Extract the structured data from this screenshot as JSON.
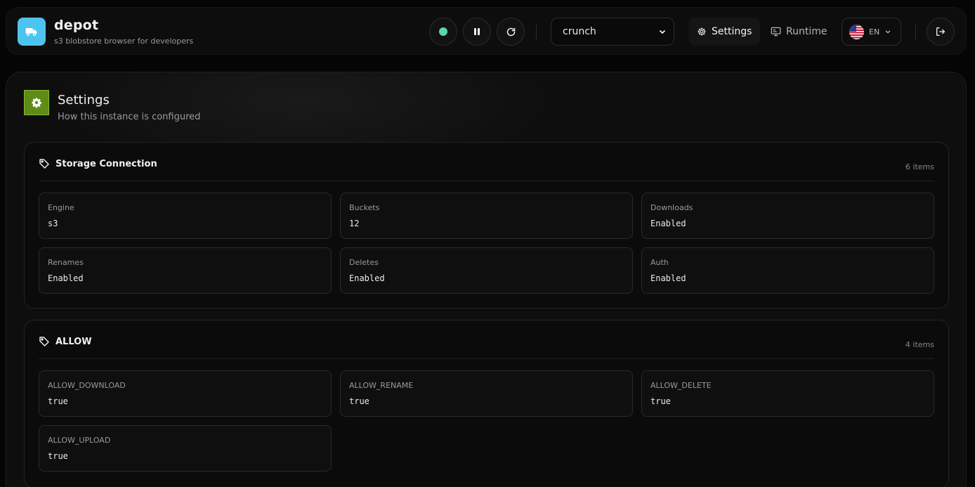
{
  "app": {
    "title": "depot",
    "subtitle": "s3 blobstore browser for developers"
  },
  "header": {
    "bucket_select": {
      "value": "crunch"
    },
    "nav": {
      "settings": "Settings",
      "runtime": "Runtime"
    },
    "language": {
      "code": "EN"
    }
  },
  "page": {
    "title": "Settings",
    "subtitle": "How this instance is configured"
  },
  "sections": [
    {
      "title": "Storage Connection",
      "count": "6 items",
      "items": [
        {
          "label": "Engine",
          "value": "s3"
        },
        {
          "label": "Buckets",
          "value": "12"
        },
        {
          "label": "Downloads",
          "value": "Enabled"
        },
        {
          "label": "Renames",
          "value": "Enabled"
        },
        {
          "label": "Deletes",
          "value": "Enabled"
        },
        {
          "label": "Auth",
          "value": "Enabled"
        }
      ]
    },
    {
      "title": "ALLOW",
      "count": "4 items",
      "items": [
        {
          "label": "ALLOW_DOWNLOAD",
          "value": "true"
        },
        {
          "label": "ALLOW_RENAME",
          "value": "true"
        },
        {
          "label": "ALLOW_DELETE",
          "value": "true"
        },
        {
          "label": "ALLOW_UPLOAD",
          "value": "true"
        }
      ]
    }
  ],
  "colors": {
    "logo": "#4cc4ef",
    "page_icon": "#5f8c17",
    "status_ok": "#5ed2ae"
  },
  "icons": [
    "truck-icon",
    "status-dot-icon",
    "pause-icon",
    "refresh-icon",
    "gear-icon",
    "monitor-icon",
    "us-flag-icon",
    "chevron-down-icon",
    "logout-icon",
    "tag-icon"
  ]
}
